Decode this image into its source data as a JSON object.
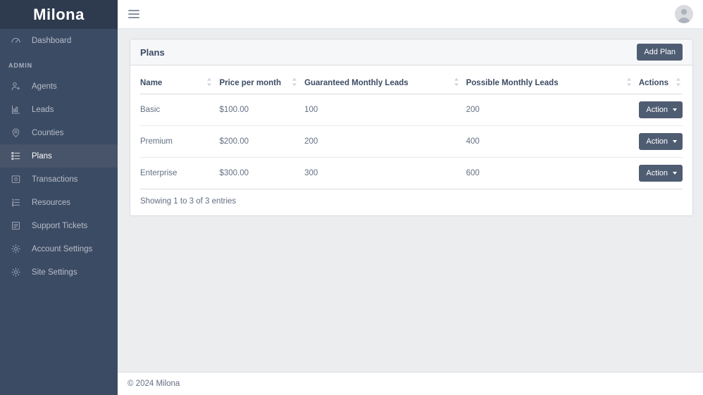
{
  "sidebar": {
    "brand": "Milona",
    "section_label": "ADMIN",
    "top_items": [
      {
        "label": "Dashboard",
        "icon": "speedometer-icon",
        "active": false
      }
    ],
    "items": [
      {
        "label": "Agents",
        "icon": "user-plus-icon",
        "active": false
      },
      {
        "label": "Leads",
        "icon": "bar-chart-icon",
        "active": false
      },
      {
        "label": "Counties",
        "icon": "map-pin-icon",
        "active": false
      },
      {
        "label": "Plans",
        "icon": "list-icon",
        "active": true
      },
      {
        "label": "Transactions",
        "icon": "transaction-icon",
        "active": false
      },
      {
        "label": "Resources",
        "icon": "ordered-list-icon",
        "active": false
      },
      {
        "label": "Support Tickets",
        "icon": "ticket-icon",
        "active": false
      },
      {
        "label": "Account Settings",
        "icon": "gear-icon",
        "active": false
      },
      {
        "label": "Site Settings",
        "icon": "gear-icon",
        "active": false
      }
    ]
  },
  "topbar": {
    "menu_toggle": "hamburger-icon",
    "avatar": "user-avatar-icon"
  },
  "card": {
    "title": "Plans",
    "add_button": "Add Plan"
  },
  "table": {
    "columns": [
      {
        "label": "Name",
        "sortable": true
      },
      {
        "label": "Price per month",
        "sortable": true
      },
      {
        "label": "Guaranteed Monthly Leads",
        "sortable": true
      },
      {
        "label": "Possible Monthly Leads",
        "sortable": true
      },
      {
        "label": "Actions",
        "sortable": true
      }
    ],
    "rows": [
      {
        "name": "Basic",
        "price": "$100.00",
        "guaranteed": "100",
        "possible": "200",
        "action": "Action"
      },
      {
        "name": "Premium",
        "price": "$200.00",
        "guaranteed": "200",
        "possible": "400",
        "action": "Action"
      },
      {
        "name": "Enterprise",
        "price": "$300.00",
        "guaranteed": "300",
        "possible": "600",
        "action": "Action"
      }
    ],
    "entries_info": "Showing 1 to 3 of 3 entries"
  },
  "footer": {
    "copyright": "© 2024 Milona"
  },
  "colors": {
    "sidebar_bg": "#3c4b64",
    "brand_bg": "#2e3a4e",
    "active_item_bg": "#475469",
    "page_bg": "#ebedef",
    "primary_button": "#4f5d73",
    "heading_text": "#3c4b64",
    "body_text": "#636f83"
  }
}
